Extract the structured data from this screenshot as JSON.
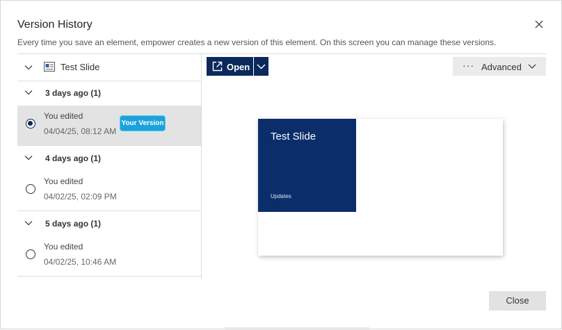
{
  "dialog": {
    "title": "Version History",
    "subtitle": "Every time you save an element, empower creates a new version of this element. On this screen you can manage these versions.",
    "close_button_label": "Close"
  },
  "tree": {
    "root_label": "Test Slide",
    "groups": [
      {
        "label": "3 days ago (1)",
        "versions": [
          {
            "action": "You edited",
            "date": "04/04/25, 08:12 AM",
            "selected": true,
            "badge": "Your Version"
          }
        ]
      },
      {
        "label": "4 days ago (1)",
        "versions": [
          {
            "action": "You edited",
            "date": "04/02/25, 02:09 PM",
            "selected": false
          }
        ]
      },
      {
        "label": "5 days ago (1)",
        "versions": [
          {
            "action": "You edited",
            "date": "04/02/25, 10:46 AM",
            "selected": false
          }
        ]
      }
    ]
  },
  "toolbar": {
    "open_label": "Open",
    "advanced_label": "Advanced",
    "advanced_dots": "···"
  },
  "preview": {
    "slide_title": "Test Slide",
    "slide_subtitle": "Updates"
  },
  "colors": {
    "primary": "#0b2a5b",
    "badge": "#1ca2db",
    "selected_row": "#e3e3e3"
  },
  "icons": [
    "close-icon",
    "chevron-down-icon",
    "slide-icon",
    "open-external-icon",
    "more-dots-icon",
    "radio-icon"
  ]
}
